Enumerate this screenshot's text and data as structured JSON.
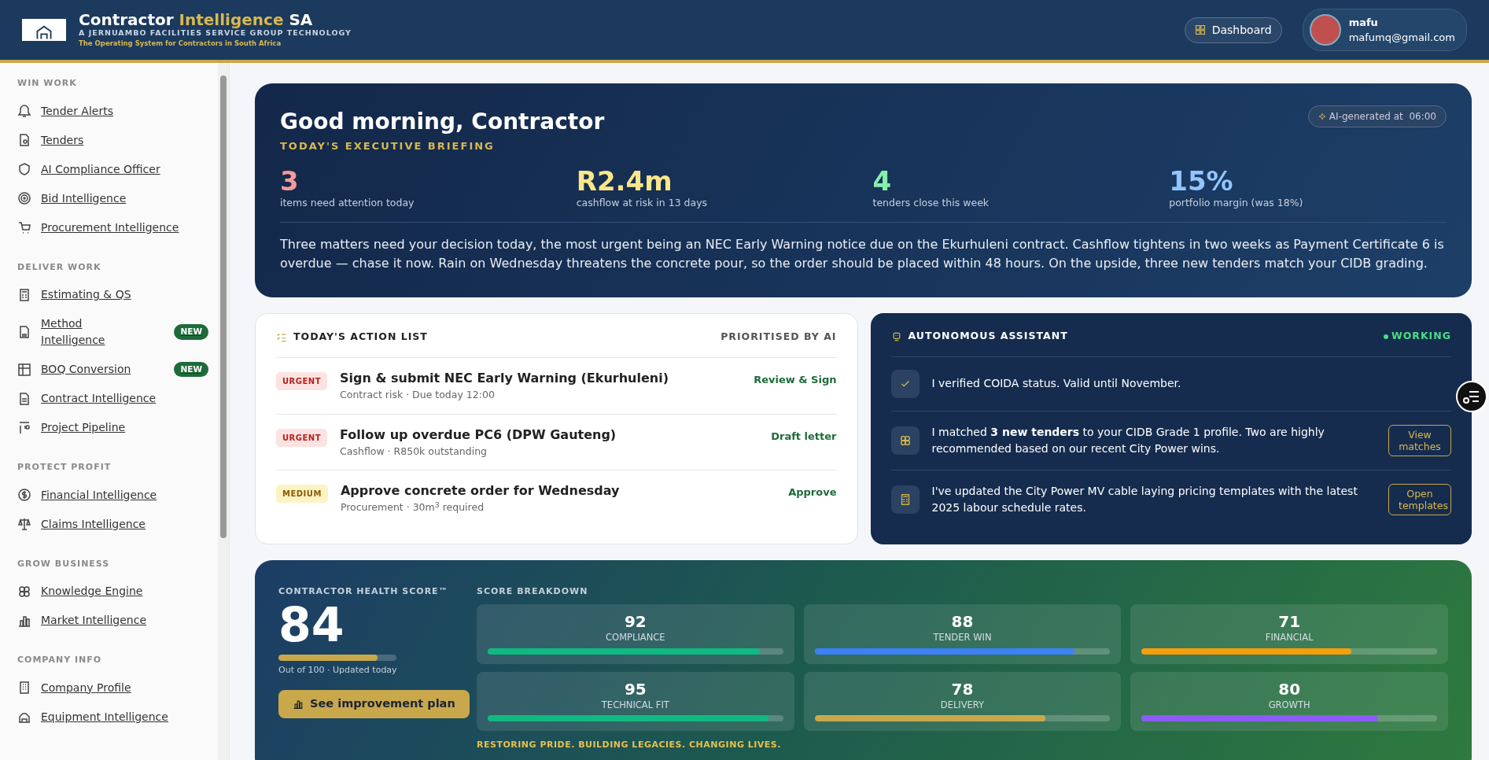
{
  "header": {
    "brand_part1": "Contractor",
    "brand_part2": "Intelligence",
    "brand_part3": "SA",
    "subtitle": "A JERNUAMBO FACILITIES SERVICE GROUP TECHNOLOGY",
    "tagline": "The Operating System for Contractors in South Africa",
    "dashboard_button": "Dashboard",
    "user": {
      "name": "mafu",
      "email": "mafumq@gmail.com"
    }
  },
  "sidebar": {
    "sections": [
      {
        "title": "WIN WORK",
        "items": [
          {
            "label": "Tender Alerts"
          },
          {
            "label": "Tenders"
          },
          {
            "label": "AI Compliance Officer"
          },
          {
            "label": "Bid Intelligence"
          },
          {
            "label": "Procurement Intelligence"
          }
        ]
      },
      {
        "title": "DELIVER WORK",
        "items": [
          {
            "label": "Estimating & QS"
          },
          {
            "label": "Method Intelligence",
            "badge": "NEW"
          },
          {
            "label": "BOQ Conversion",
            "badge": "NEW"
          },
          {
            "label": "Contract Intelligence"
          },
          {
            "label": "Project Pipeline"
          }
        ]
      },
      {
        "title": "PROTECT PROFIT",
        "items": [
          {
            "label": "Financial Intelligence"
          },
          {
            "label": "Claims Intelligence"
          }
        ]
      },
      {
        "title": "GROW BUSINESS",
        "items": [
          {
            "label": "Knowledge Engine"
          },
          {
            "label": "Market Intelligence"
          }
        ]
      },
      {
        "title": "COMPANY INFO",
        "items": [
          {
            "label": "Company Profile"
          },
          {
            "label": "Equipment Intelligence"
          }
        ]
      }
    ]
  },
  "briefing": {
    "greeting": "Good morning, Contractor",
    "subtitle": "TODAY'S EXECUTIVE BRIEFING",
    "ai_badge": "AI-generated at  06:00",
    "stats": [
      {
        "value": "3",
        "label": "items need attention today",
        "color": "#f79a9a"
      },
      {
        "value": "R2.4m",
        "label": "cashflow at risk in 13 days",
        "color": "#fde68a"
      },
      {
        "value": "4",
        "label": "tenders close this week",
        "color": "#86efac"
      },
      {
        "value": "15%",
        "label": "portfolio margin (was 18%)",
        "color": "#93c5fd"
      }
    ],
    "summary": "Three matters need your decision today, the most urgent being an NEC Early Warning notice due on the Ekurhuleni contract. Cashflow tightens in two weeks as Payment Certificate 6 is overdue — chase it now. Rain on Wednesday threatens the concrete pour, so the order should be placed within 48 hours. On the upside, three new tenders match your CIDB grading."
  },
  "action_list": {
    "title": "TODAY'S ACTION LIST",
    "note": "PRIORITISED BY AI",
    "items": [
      {
        "kind": "urgent",
        "tag": "URGENT",
        "title": "Sign & submit NEC Early Warning (Ekurhuleni)",
        "meta": "Contract risk · Due today 12:00",
        "action": "Review & Sign"
      },
      {
        "kind": "urgent",
        "tag": "URGENT",
        "title": "Follow up overdue PC6 (DPW Gauteng)",
        "meta": "Cashflow · R850k outstanding",
        "action": "Draft letter"
      },
      {
        "kind": "medium",
        "tag": "MEDIUM",
        "title": "Approve concrete order for Wednesday",
        "meta": "Procurement · 30m$^{3}$ required",
        "action": "Approve"
      }
    ]
  },
  "assistant": {
    "title": "AUTONOMOUS ASSISTANT",
    "status": "WORKING",
    "items": [
      {
        "kind": "check",
        "text": "I verified COIDA status. Valid until November."
      },
      {
        "kind": "brain",
        "text": "I matched **3 new tenders** to your CIDB Grade 1 profile. Two are highly recommended based on our recent City Power wins.",
        "button": "View matches"
      },
      {
        "kind": "calculator",
        "text": "I've updated the City Power MV cable laying pricing templates with the latest 2025 labour schedule rates.",
        "button": "Open templates"
      }
    ]
  },
  "health": {
    "title": "CONTRACTOR HEALTH SCORE™",
    "score": "84",
    "level": 0.84,
    "caption": "Out of 100 · Updated today",
    "button": "See improvement plan",
    "breakdown_title": "SCORE BREAKDOWN",
    "breakdown": [
      {
        "value": "92",
        "label": "COMPLIANCE",
        "level": 0.92,
        "color": "#10b981"
      },
      {
        "value": "88",
        "label": "TENDER WIN",
        "level": 0.88,
        "color": "#3b82f6"
      },
      {
        "value": "71",
        "label": "FINANCIAL",
        "level": 0.71,
        "color": "#f59e0b"
      },
      {
        "value": "95",
        "label": "TECHNICAL FIT",
        "level": 0.95,
        "color": "#10b981"
      },
      {
        "value": "78",
        "label": "DELIVERY",
        "level": 0.78,
        "color": "#c9a84c"
      },
      {
        "value": "80",
        "label": "GROWTH",
        "level": 0.8,
        "color": "#8b5cf6"
      }
    ],
    "slogan": "RESTORING PRIDE. BUILDING LEGACIES. CHANGING LIVES."
  }
}
